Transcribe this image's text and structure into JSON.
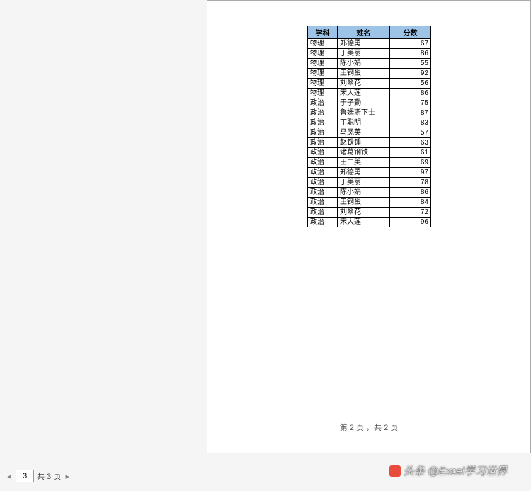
{
  "table": {
    "headers": {
      "subject": "学科",
      "name": "姓名",
      "score": "分数"
    },
    "rows": [
      {
        "subject": "物理",
        "name": "郑德勇",
        "score": 67
      },
      {
        "subject": "物理",
        "name": "丁美丽",
        "score": 86
      },
      {
        "subject": "物理",
        "name": "陈小娟",
        "score": 55
      },
      {
        "subject": "物理",
        "name": "王钢蛋",
        "score": 92
      },
      {
        "subject": "物理",
        "name": "刘翠花",
        "score": 56
      },
      {
        "subject": "物理",
        "name": "宋大莲",
        "score": 86
      },
      {
        "subject": "政治",
        "name": "于子勤",
        "score": 75
      },
      {
        "subject": "政治",
        "name": "鲁姆斯下士",
        "score": 87
      },
      {
        "subject": "政治",
        "name": "丁聪明",
        "score": 83
      },
      {
        "subject": "政治",
        "name": "马凤英",
        "score": 57
      },
      {
        "subject": "政治",
        "name": "赵铁锤",
        "score": 63
      },
      {
        "subject": "政治",
        "name": "诸葛钢铁",
        "score": 61
      },
      {
        "subject": "政治",
        "name": "王二美",
        "score": 69
      },
      {
        "subject": "政治",
        "name": "郑德勇",
        "score": 97
      },
      {
        "subject": "政治",
        "name": "丁美丽",
        "score": 78
      },
      {
        "subject": "政治",
        "name": "陈小娟",
        "score": 86
      },
      {
        "subject": "政治",
        "name": "王钢蛋",
        "score": 84
      },
      {
        "subject": "政治",
        "name": "刘翠花",
        "score": 72
      },
      {
        "subject": "政治",
        "name": "宋大莲",
        "score": 96
      }
    ]
  },
  "page_footer": "第 2 页 ，共 2 页",
  "pagination": {
    "current": "3",
    "total_label": "共 3 页"
  },
  "watermark": "头条 @Excel学习世界"
}
